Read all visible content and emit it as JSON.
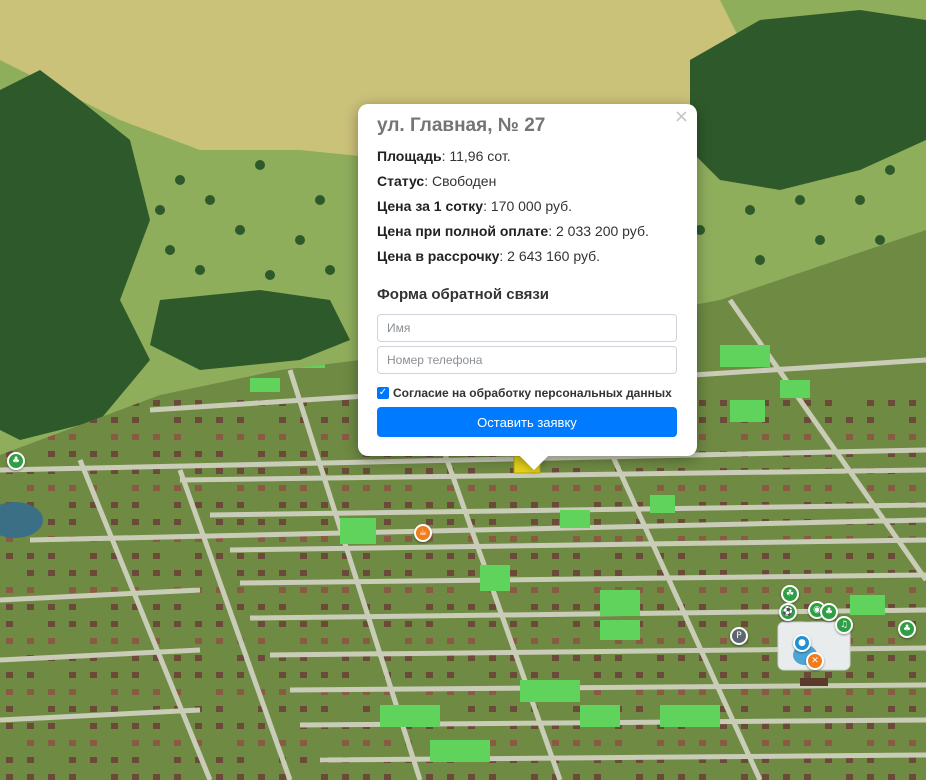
{
  "popup": {
    "title": "ул. Главная, № 27",
    "close_icon": "×",
    "rows": [
      {
        "label": "Площадь",
        "value": ": 11,96 сот."
      },
      {
        "label": "Статус",
        "value": ": Свободен"
      },
      {
        "label": "Цена за 1 сотку",
        "value": ": 170 000 руб."
      },
      {
        "label": "Цена при полной оплате",
        "value": ": 2 033 200 руб."
      },
      {
        "label": "Цена в рассрочку",
        "value": ": 2 643 160 руб."
      }
    ],
    "form": {
      "title": "Форма обратной связи",
      "name_placeholder": "Имя",
      "phone_placeholder": "Номер телефона",
      "consent_label": "Согласие на обработку персональных данных",
      "consent_checked": true,
      "submit_label": "Оставить заявку"
    }
  },
  "map": {
    "colors": {
      "field": "#cbc27a",
      "grass": "#8fae5c",
      "forest": "#2e5a2b",
      "road": "#c9cdb8",
      "plot": "#6f8a43",
      "free_plot": "#5fd35c",
      "selected_plot": "#e6d21a",
      "lake": "#3b6f86"
    },
    "pois": [
      {
        "name": "tree-poi-icon",
        "color": "#2f9e44",
        "glyph": "♣"
      },
      {
        "name": "food-poi-icon",
        "color": "#f07c1b",
        "glyph": "☕"
      },
      {
        "name": "playground-poi-icon",
        "color": "#2f9e44",
        "glyph": "☘"
      },
      {
        "name": "sport-poi-icon",
        "color": "#2f9e44",
        "glyph": "⚽"
      },
      {
        "name": "basketball-poi-icon",
        "color": "#2f9e44",
        "glyph": "◉"
      },
      {
        "name": "music-poi-icon",
        "color": "#2f9e44",
        "glyph": "♫"
      },
      {
        "name": "parking-poi-icon",
        "color": "#5e6670",
        "glyph": "P"
      },
      {
        "name": "water-poi-icon",
        "color": "#1e90d6",
        "glyph": "●"
      },
      {
        "name": "restaurant-poi-icon",
        "color": "#f07c1b",
        "glyph": "✕"
      },
      {
        "name": "park-poi-icon",
        "color": "#2f9e44",
        "glyph": "♣"
      },
      {
        "name": "forest-poi-icon",
        "color": "#2f9e44",
        "glyph": "♣"
      }
    ]
  }
}
